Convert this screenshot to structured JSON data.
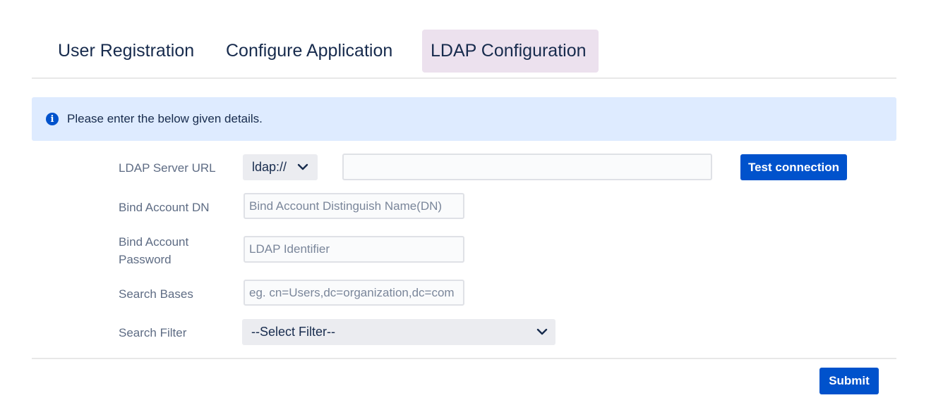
{
  "tabs": [
    {
      "label": "User Registration"
    },
    {
      "label": "Configure Application"
    },
    {
      "label": "LDAP Configuration",
      "active": true
    }
  ],
  "info_banner": {
    "icon": "info-icon",
    "text": "Please enter the below given details."
  },
  "form": {
    "server_url": {
      "label": "LDAP Server URL",
      "protocol": "ldap://",
      "value": "",
      "placeholder": ""
    },
    "bind_dn": {
      "label": "Bind Account DN",
      "value": "",
      "placeholder": "Bind Account Distinguish Name(DN)"
    },
    "bind_password": {
      "label": "Bind Account Password",
      "value": "",
      "placeholder": "LDAP Identifier"
    },
    "search_bases": {
      "label": "Search Bases",
      "value": "",
      "placeholder": "eg. cn=Users,dc=organization,dc=com"
    },
    "search_filter": {
      "label": "Search Filter",
      "selected": "--Select Filter--"
    }
  },
  "buttons": {
    "test_connection": "Test connection",
    "submit": "Submit"
  },
  "colors": {
    "primary": "#0052cc",
    "active_tab_bg": "#ece1ee",
    "banner_bg": "#deebff",
    "select_bg": "#ebecf0"
  }
}
